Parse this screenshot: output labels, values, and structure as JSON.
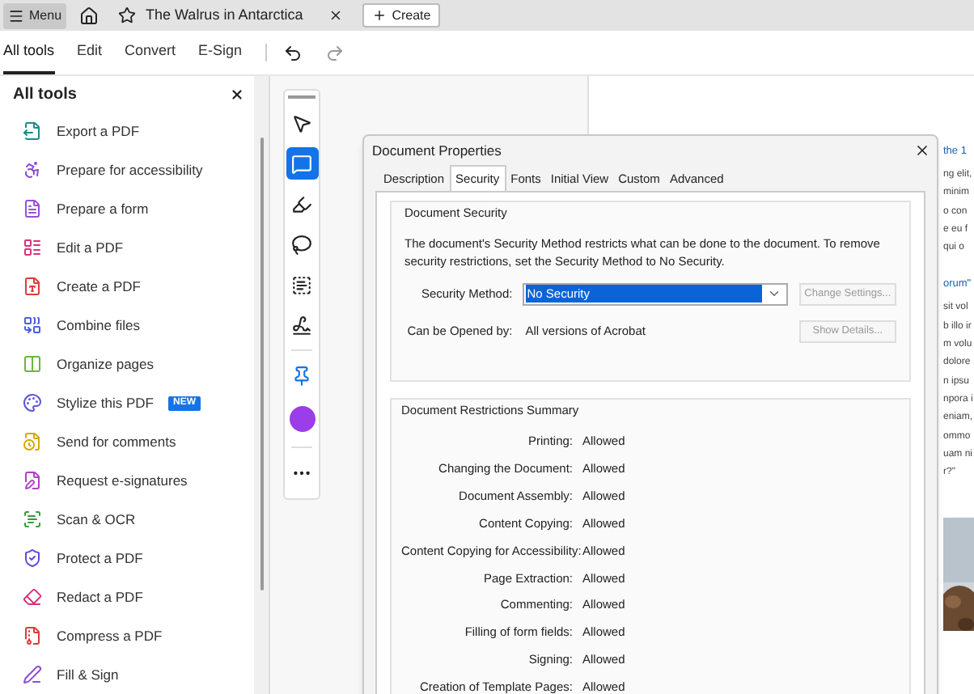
{
  "tab_bar": {
    "menu_button": "Menu",
    "tabs": [
      {
        "title": "The Walrus in Antarctica",
        "selected": true
      }
    ],
    "create_button": "Create"
  },
  "toolbar": {
    "items": [
      {
        "label": "All tools",
        "selected": true
      },
      {
        "label": "Edit",
        "selected": false
      },
      {
        "label": "Convert",
        "selected": false
      },
      {
        "label": "E-Sign",
        "selected": false
      }
    ]
  },
  "tools_panel": {
    "title": "All tools",
    "items": [
      {
        "label": "Export a PDF",
        "color": "#1a8a8a"
      },
      {
        "label": "Prepare for accessibility",
        "color": "#8a4fd6"
      },
      {
        "label": "Prepare a form",
        "color": "#9a4fd6"
      },
      {
        "label": "Edit a PDF",
        "color": "#d9317a"
      },
      {
        "label": "Create a PDF",
        "color": "#e03a3a"
      },
      {
        "label": "Combine files",
        "color": "#4b5fe0"
      },
      {
        "label": "Organize pages",
        "color": "#6bb83a"
      },
      {
        "label": "Stylize this PDF",
        "color": "#5b55d8",
        "badge": "NEW"
      },
      {
        "label": "Send for comments",
        "color": "#d9a800"
      },
      {
        "label": "Request e-signatures",
        "color": "#b23fc4"
      },
      {
        "label": "Scan & OCR",
        "color": "#3a9a3a"
      },
      {
        "label": "Protect a PDF",
        "color": "#5b4fd6"
      },
      {
        "label": "Redact a PDF",
        "color": "#d9317a"
      },
      {
        "label": "Compress a PDF",
        "color": "#e03a3a"
      },
      {
        "label": "Fill & Sign",
        "color": "#8a4fd6"
      }
    ]
  },
  "annotation_toolbar": {
    "groups": [
      [
        {
          "kind": "select",
          "selected": false
        },
        {
          "kind": "comment",
          "selected": true
        },
        {
          "kind": "draw",
          "selected": false
        },
        {
          "kind": "lasso",
          "selected": false
        },
        {
          "kind": "text",
          "selected": false
        },
        {
          "kind": "sign",
          "selected": false
        }
      ],
      [
        {
          "kind": "pin",
          "selected": false
        },
        {
          "kind": "color",
          "selected": false,
          "color": "#9b3de8"
        }
      ],
      [
        {
          "kind": "more",
          "selected": false
        }
      ]
    ]
  },
  "dialog": {
    "title": "Document Properties",
    "tabs": [
      {
        "label": "Description",
        "selected": false
      },
      {
        "label": "Security",
        "selected": true
      },
      {
        "label": "Fonts",
        "selected": false
      },
      {
        "label": "Initial View",
        "selected": false
      },
      {
        "label": "Custom",
        "selected": false
      },
      {
        "label": "Advanced",
        "selected": false
      }
    ],
    "security": {
      "title": "Document Security",
      "description": "The document's Security Method restricts what can be done to the document. To remove security restrictions, set the Security Method to No Security.",
      "method_label": "Security Method:",
      "method_value": "No Security",
      "change_button": {
        "label": "Change Settings...",
        "disabled": true
      },
      "opened_label": "Can be Opened by:",
      "opened_value": "All versions of Acrobat",
      "details_button": {
        "label": "Show Details...",
        "disabled": true
      }
    },
    "restrictions": {
      "title": "Document Restrictions Summary",
      "rows": [
        {
          "label": "Printing:",
          "value": "Allowed"
        },
        {
          "label": "Changing the Document:",
          "value": "Allowed"
        },
        {
          "label": "Document Assembly:",
          "value": "Allowed"
        },
        {
          "label": "Content Copying:",
          "value": "Allowed"
        },
        {
          "label": "Content Copying for Accessibility:",
          "value": "Allowed"
        },
        {
          "label": "Page Extraction:",
          "value": "Allowed"
        },
        {
          "label": "Commenting:",
          "value": "Allowed"
        },
        {
          "label": "Filling of form fields:",
          "value": "Allowed"
        },
        {
          "label": "Signing:",
          "value": "Allowed"
        },
        {
          "label": "Creation of Template Pages:",
          "value": "Allowed"
        }
      ]
    }
  },
  "page_fragments": [
    {
      "kind": "heading",
      "text": "the 1"
    },
    {
      "kind": "body",
      "text": "ng elit,"
    },
    {
      "kind": "body",
      "text": "minim"
    },
    {
      "kind": "body",
      "text": "o con"
    },
    {
      "kind": "body",
      "text": "e eu f"
    },
    {
      "kind": "body",
      "text": "qui o"
    },
    {
      "kind": "heading",
      "text": "orum\""
    },
    {
      "kind": "body",
      "text": "sit vol"
    },
    {
      "kind": "body",
      "text": "b illo ir"
    },
    {
      "kind": "body",
      "text": "m volu"
    },
    {
      "kind": "body",
      "text": "dolore"
    },
    {
      "kind": "body",
      "text": "n ipsu"
    },
    {
      "kind": "body",
      "text": "npora i"
    },
    {
      "kind": "body",
      "text": "eniam,"
    },
    {
      "kind": "body",
      "text": "ommo"
    },
    {
      "kind": "body",
      "text": "uam ni"
    },
    {
      "kind": "body",
      "text": "r?\""
    },
    {
      "kind": "picture"
    }
  ]
}
